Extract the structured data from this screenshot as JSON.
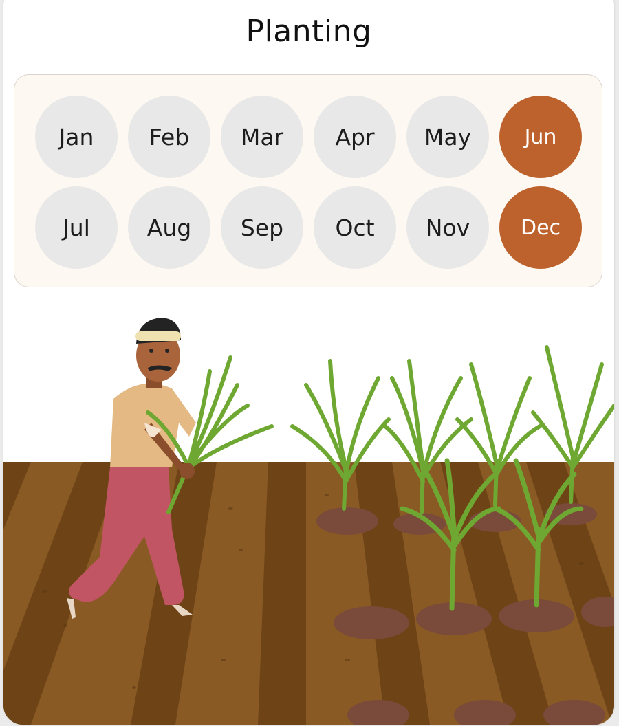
{
  "title": "Planting",
  "months": [
    {
      "label": "Jan",
      "active": false
    },
    {
      "label": "Feb",
      "active": false
    },
    {
      "label": "Mar",
      "active": false
    },
    {
      "label": "Apr",
      "active": false
    },
    {
      "label": "May",
      "active": false
    },
    {
      "label": "Jun",
      "active": true
    },
    {
      "label": "Jul",
      "active": false
    },
    {
      "label": "Aug",
      "active": false
    },
    {
      "label": "Sep",
      "active": false
    },
    {
      "label": "Oct",
      "active": false
    },
    {
      "label": "Nov",
      "active": false
    },
    {
      "label": "Dec",
      "active": true
    }
  ],
  "colors": {
    "active_month": "#bd622c",
    "inactive_month": "#e8e8e8",
    "panel_bg": "#fdf8f1",
    "soil_dark": "#6e4417",
    "soil_light": "#8a5a25",
    "plant": "#6ea832"
  },
  "illustration": {
    "subject": "farmer-transplanting-rice-seedlings",
    "icon": "farmer-planting-illustration"
  }
}
